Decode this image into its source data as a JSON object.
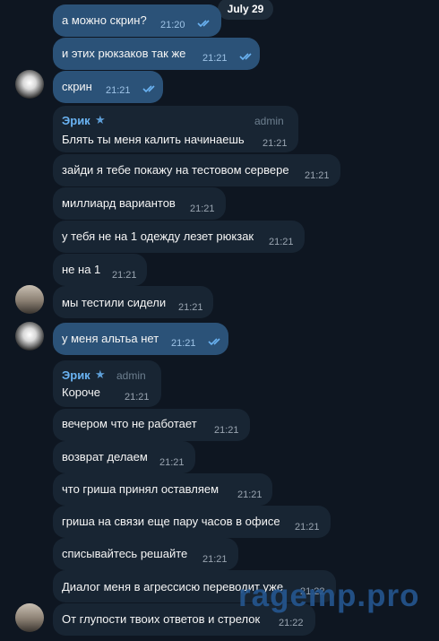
{
  "date_label": "July 29",
  "messages": [
    {
      "sender": "",
      "tag": "",
      "text": "а можно скрин?",
      "time": "21:20",
      "dir": "out"
    },
    {
      "sender": "",
      "tag": "",
      "text": "и этих рюкзаков так же",
      "time": "21:21",
      "dir": "out"
    },
    {
      "sender": "",
      "tag": "",
      "text": "скрин",
      "time": "21:21",
      "dir": "out"
    },
    {
      "sender": "Эрик",
      "tag": "admin",
      "text": "Блять ты меня калить начинаешь",
      "time": "21:21",
      "dir": "in"
    },
    {
      "sender": "",
      "tag": "",
      "text": "зайди я тебе покажу на тестовом сервере",
      "time": "21:21",
      "dir": "in"
    },
    {
      "sender": "",
      "tag": "",
      "text": "миллиард вариантов",
      "time": "21:21",
      "dir": "in"
    },
    {
      "sender": "",
      "tag": "",
      "text": "у тебя не на 1 одежду лезет рюкзак",
      "time": "21:21",
      "dir": "in"
    },
    {
      "sender": "",
      "tag": "",
      "text": "не на 1",
      "time": "21:21",
      "dir": "in"
    },
    {
      "sender": "",
      "tag": "",
      "text": "мы тестили сидели",
      "time": "21:21",
      "dir": "in"
    },
    {
      "sender": "",
      "tag": "",
      "text": "у меня альтьа нет",
      "time": "21:21",
      "dir": "out"
    },
    {
      "sender": "Эрик",
      "tag": "admin",
      "text": "Короче",
      "time": "21:21",
      "dir": "in"
    },
    {
      "sender": "",
      "tag": "",
      "text": "вечером что не работает",
      "time": "21:21",
      "dir": "in"
    },
    {
      "sender": "",
      "tag": "",
      "text": "возврат делаем",
      "time": "21:21",
      "dir": "in"
    },
    {
      "sender": "",
      "tag": "",
      "text": "что гриша принял оставляем",
      "time": "21:21",
      "dir": "in"
    },
    {
      "sender": "",
      "tag": "",
      "text": "гриша на связи еще пару часов в офисе",
      "time": "21:21",
      "dir": "in"
    },
    {
      "sender": "",
      "tag": "",
      "text": "списывайтесь решайте",
      "time": "21:21",
      "dir": "in"
    },
    {
      "sender": "",
      "tag": "",
      "text": "Диалог меня в агрессисю переводит уже",
      "time": "21:22",
      "dir": "in"
    },
    {
      "sender": "",
      "tag": "",
      "text": "От глупости твоих ответов и стрелок",
      "time": "21:22",
      "dir": "in"
    }
  ],
  "watermark": "ragemp.pro",
  "colors": {
    "background": "#0e1621",
    "incoming": "#182533",
    "outgoing": "#2b5278",
    "sender": "#6ab3f3",
    "check": "#6ab3f3"
  }
}
